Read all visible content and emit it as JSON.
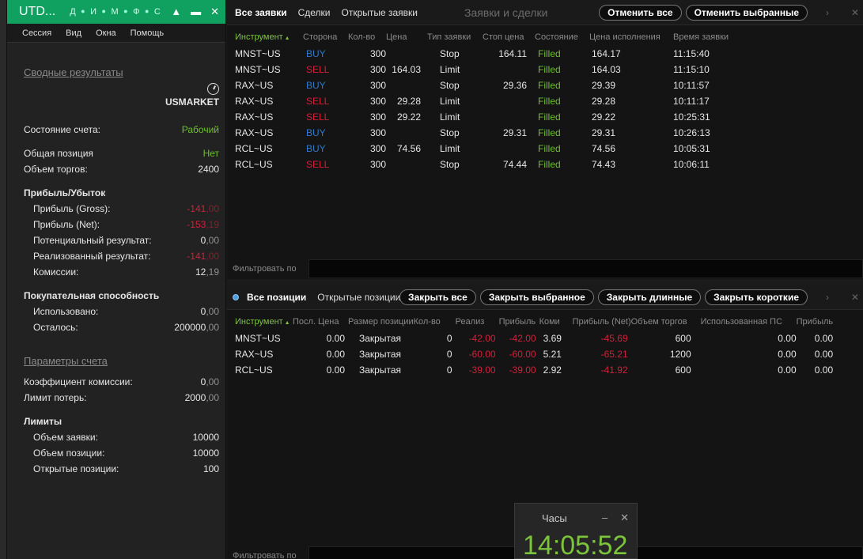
{
  "left": {
    "app_title": "UTD...",
    "mini_icons": [
      "Д",
      "И",
      "М",
      "Ф",
      "С"
    ],
    "menu": [
      "Сессия",
      "Вид",
      "Окна",
      "Помощь"
    ],
    "summary_link": "Сводные результаты",
    "market": "USMARKET",
    "account_state_label": "Состояние счета:",
    "account_state_value": "Рабочий",
    "total_position_label": "Общая позиция",
    "total_position_value": "Нет",
    "volume_label": "Объем торгов:",
    "volume_value": "2400",
    "pnl_head": "Прибыль/Убыток",
    "pnl": [
      {
        "label": "Прибыль (Gross):",
        "int": "-141",
        "dec": ",00",
        "color": "#d2203a"
      },
      {
        "label": "Прибыль (Net):",
        "int": "-153",
        "dec": ",19",
        "color": "#d2203a"
      },
      {
        "label": "Потенциальный результат:",
        "int": "0",
        "dec": ",00",
        "color": "#e6e6e6"
      },
      {
        "label": "Реализованный результат:",
        "int": "-141",
        "dec": ",00",
        "color": "#d2203a"
      },
      {
        "label": "Комиссии:",
        "int": "12",
        "dec": ",19",
        "color": "#e6e6e6"
      }
    ],
    "bp_head": "Покупательная способность",
    "bp": [
      {
        "label": "Использовано:",
        "int": "0",
        "dec": ",00"
      },
      {
        "label": "Осталось:",
        "int": "200000",
        "dec": ",00"
      }
    ],
    "params_link": "Параметры счета",
    "params": [
      {
        "label": "Коэффициент комиссии:",
        "int": "0",
        "dec": ",00"
      },
      {
        "label": "Лимит потерь:",
        "int": "2000",
        "dec": ",00"
      }
    ],
    "limits_head": "Лимиты",
    "limits": [
      {
        "label": "Объем заявки:",
        "value": "10000"
      },
      {
        "label": "Объем позиции:",
        "value": "10000"
      },
      {
        "label": "Открытые позиции:",
        "value": "100"
      }
    ]
  },
  "orders": {
    "tabs": [
      "Все заявки",
      "Сделки",
      "Открытые заявки"
    ],
    "title": "Заявки и сделки",
    "cancel_all": "Отменить все",
    "cancel_selected": "Отменить выбранные",
    "columns": [
      "Инструмент",
      "Сторона",
      "Кол-во",
      "Цена",
      "Тип заявки",
      "Стоп цена",
      "Состояние",
      "Цена исполнения",
      "Время заявки"
    ],
    "rows": [
      {
        "instr": "MNST~US",
        "side": "BUY",
        "qty": "300",
        "price": "",
        "type": "Stop",
        "stop": "164.11",
        "state": "Filled",
        "exec": "164.17",
        "time": "11:15:40"
      },
      {
        "instr": "MNST~US",
        "side": "SELL",
        "qty": "300",
        "price": "164.03",
        "type": "Limit",
        "stop": "",
        "state": "Filled",
        "exec": "164.03",
        "time": "11:15:10"
      },
      {
        "instr": "RAX~US",
        "side": "BUY",
        "qty": "300",
        "price": "",
        "type": "Stop",
        "stop": "29.36",
        "state": "Filled",
        "exec": "29.39",
        "time": "10:11:57"
      },
      {
        "instr": "RAX~US",
        "side": "SELL",
        "qty": "300",
        "price": "29.28",
        "type": "Limit",
        "stop": "",
        "state": "Filled",
        "exec": "29.28",
        "time": "10:11:17"
      },
      {
        "instr": "RAX~US",
        "side": "SELL",
        "qty": "300",
        "price": "29.22",
        "type": "Limit",
        "stop": "",
        "state": "Filled",
        "exec": "29.22",
        "time": "10:25:31"
      },
      {
        "instr": "RAX~US",
        "side": "BUY",
        "qty": "300",
        "price": "",
        "type": "Stop",
        "stop": "29.31",
        "state": "Filled",
        "exec": "29.31",
        "time": "10:26:13"
      },
      {
        "instr": "RCL~US",
        "side": "BUY",
        "qty": "300",
        "price": "74.56",
        "type": "Limit",
        "stop": "",
        "state": "Filled",
        "exec": "74.56",
        "time": "10:05:31"
      },
      {
        "instr": "RCL~US",
        "side": "SELL",
        "qty": "300",
        "price": "",
        "type": "Stop",
        "stop": "74.44",
        "state": "Filled",
        "exec": "74.43",
        "time": "10:06:11"
      }
    ],
    "filter_label": "Фильтровать по"
  },
  "positions": {
    "tabs": [
      "Все позиции",
      "Открытые позиции"
    ],
    "close_all": "Закрыть все",
    "close_selected": "Закрыть выбранное",
    "close_long": "Закрыть длинные",
    "close_short": "Закрыть короткие",
    "columns": [
      "Инструмент",
      "Посл. Цена",
      "Размер позиции",
      "Кол-во",
      "Реализ",
      "Прибыль",
      "Коми",
      "Прибыль (Net)",
      "Объем торгов",
      "Использованная ПС",
      "Прибыль"
    ],
    "rows": [
      {
        "instr": "MNST~US",
        "last": "0.00",
        "size": "Закрытая",
        "qty": "0",
        "real": "-42.00",
        "pnl": "-42.00",
        "comm": "3.69",
        "net": "-45.69",
        "vol": "600",
        "used": "0.00",
        "p2": "0.00"
      },
      {
        "instr": "RAX~US",
        "last": "0.00",
        "size": "Закрытая",
        "qty": "0",
        "real": "-60.00",
        "pnl": "-60.00",
        "comm": "5.21",
        "net": "-65.21",
        "vol": "1200",
        "used": "0.00",
        "p2": "0.00"
      },
      {
        "instr": "RCL~US",
        "last": "0.00",
        "size": "Закрытая",
        "qty": "0",
        "real": "-39.00",
        "pnl": "-39.00",
        "comm": "2.92",
        "net": "-41.92",
        "vol": "600",
        "used": "0.00",
        "p2": "0.00"
      }
    ],
    "filter_label": "Фильтровать по"
  },
  "clock": {
    "title": "Часы",
    "time": "14:05:52"
  },
  "colors": {
    "accent": "#10a060",
    "buy": "#2f79c9",
    "sell": "#d2203a",
    "filled": "#6fbf30"
  }
}
